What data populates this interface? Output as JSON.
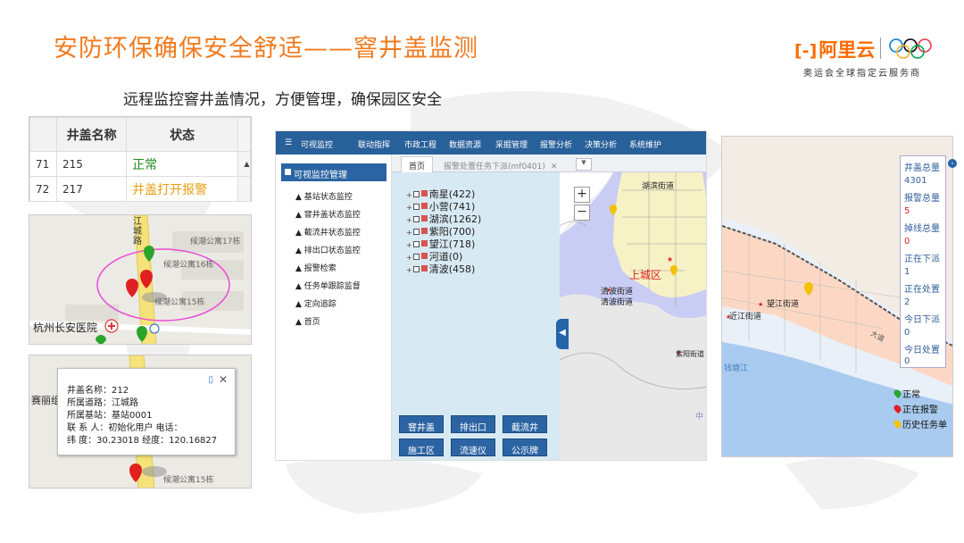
{
  "slide": {
    "title": "安防环保确保安全舒适——窨井盖监测",
    "subtitle": "远程监控窨井盖情况，方便管理，确保园区安全"
  },
  "logo": {
    "brand": "阿里云",
    "tagline": "奥运会全球指定云服务商",
    "brand_color": "#ff6a00"
  },
  "status_table": {
    "headers": [
      "井盖名称",
      "状态"
    ],
    "rows": [
      {
        "index": "71",
        "name": "215",
        "status": "正常"
      },
      {
        "index": "72",
        "name": "217",
        "status": "井盖打开报警"
      }
    ]
  },
  "map1": {
    "road": "江城路",
    "buildings": [
      "候潮公寓17栋",
      "候潮公寓16栋",
      "候潮公寓15栋"
    ],
    "hospital": "杭州长安医院"
  },
  "map2": {
    "side_label": "赛丽组",
    "building": "候潮公寓15栋"
  },
  "popup": {
    "lines": [
      "井盖名称：212",
      "所属道路：江城路",
      "所属基站：基站0001",
      "联  系  人：初始化用户    电话：",
      "纬      度：30.23018   经度：120.16827"
    ]
  },
  "app": {
    "menu": [
      "可视监控",
      "联动指挥",
      "市政工程",
      "数据资源",
      "采掘管理",
      "报警分析",
      "决策分析",
      "系统维护"
    ],
    "sidebar_title": "可视监控管理",
    "sidebar_items": [
      "基站状态监控",
      "窨井盖状态监控",
      "截流井状态监控",
      "排出口状态监控",
      "报警检索",
      "任务单跟踪监督",
      "定向追踪",
      "首页"
    ],
    "tabs": [
      "首页",
      "报警处置任务下派(mf0401)"
    ],
    "tree": [
      "南星(422)",
      "小营(741)",
      "湖滨(1262)",
      "紫阳(700)",
      "望江(718)",
      "河道(0)",
      "清波(458)"
    ],
    "buttons": [
      "窨井盖",
      "排出口",
      "截流井",
      "施工区",
      "流速仪",
      "公示牌"
    ],
    "map_labels": {
      "street1": "湖滨街道",
      "district": "上城区",
      "street2": "清波街道",
      "street2b": "清波街道",
      "street3": "紫阳街道",
      "street3_prefix": "紫",
      "zoom_in": "+",
      "zoom_out": "−",
      "bottom": "中"
    }
  },
  "right_map": {
    "stats": [
      {
        "label": "井盖总量",
        "value": "4301"
      },
      {
        "label": "报警总量",
        "value": "5"
      },
      {
        "label": "掉线总量",
        "value": "0"
      },
      {
        "label": "正在下派",
        "value": "1"
      },
      {
        "label": "正在处置",
        "value": "2"
      },
      {
        "label": "今日下派",
        "value": "0"
      },
      {
        "label": "今日处置",
        "value": "0"
      }
    ],
    "legend": [
      "正常",
      "正在报警",
      "历史任务单"
    ],
    "labels": {
      "street1": "望江街道",
      "street2": "近江街道",
      "river": "钱塘江",
      "fragment": "大道"
    },
    "colors": {
      "normal": "#2aa52a",
      "alarm": "#e02020",
      "history": "#f2c200"
    }
  }
}
